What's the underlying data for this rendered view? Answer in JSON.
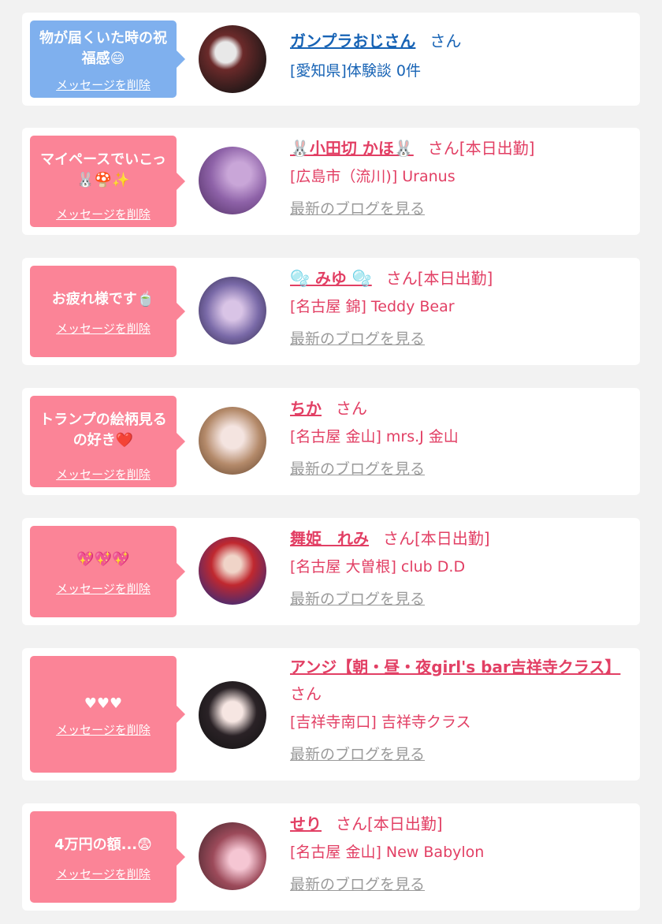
{
  "colors": {
    "bubble_blue": "#7fb0ee",
    "bubble_pink": "#fb8497",
    "text_blue": "#1763b5",
    "text_pink": "#e23f64",
    "link_gray": "#9a9a9a"
  },
  "delete_label": "メッセージを削除",
  "blog_label": "最新のブログを見る",
  "items": [
    {
      "message": "物が届くいた時の祝福感😄",
      "name": "ガンプラおじさん",
      "suffix": "さん",
      "location": "[愛知県]体験談 0件"
    },
    {
      "message": "マイペースでいこっ🐰🍄✨",
      "name": "🐰小田切 かほ🐰",
      "suffix": "さん[本日出勤]",
      "location": "[広島市（流川)] Uranus"
    },
    {
      "message": "お疲れ様です🍵",
      "name": "🫧 みゆ 🫧",
      "suffix": "さん[本日出勤]",
      "location": "[名古屋 錦] Teddy Bear"
    },
    {
      "message": "トランプの絵柄見るの好き❤️",
      "name": "ちか",
      "suffix": "さん",
      "location": "[名古屋 金山] mrs.J 金山"
    },
    {
      "message": "💖💖💖",
      "name": "舞姫　れみ",
      "suffix": "さん[本日出勤]",
      "location": "[名古屋 大曽根] club D.D"
    },
    {
      "message": "♥♥♥",
      "name": "アンジ【朝・昼・夜girl's bar吉祥寺クラス】",
      "suffix": "さん",
      "location": "[吉祥寺南口] 吉祥寺クラス"
    },
    {
      "message": "4万円の額...😨",
      "name": "せり",
      "suffix": "さん[本日出勤]",
      "location": "[名古屋 金山] New Babylon"
    }
  ]
}
